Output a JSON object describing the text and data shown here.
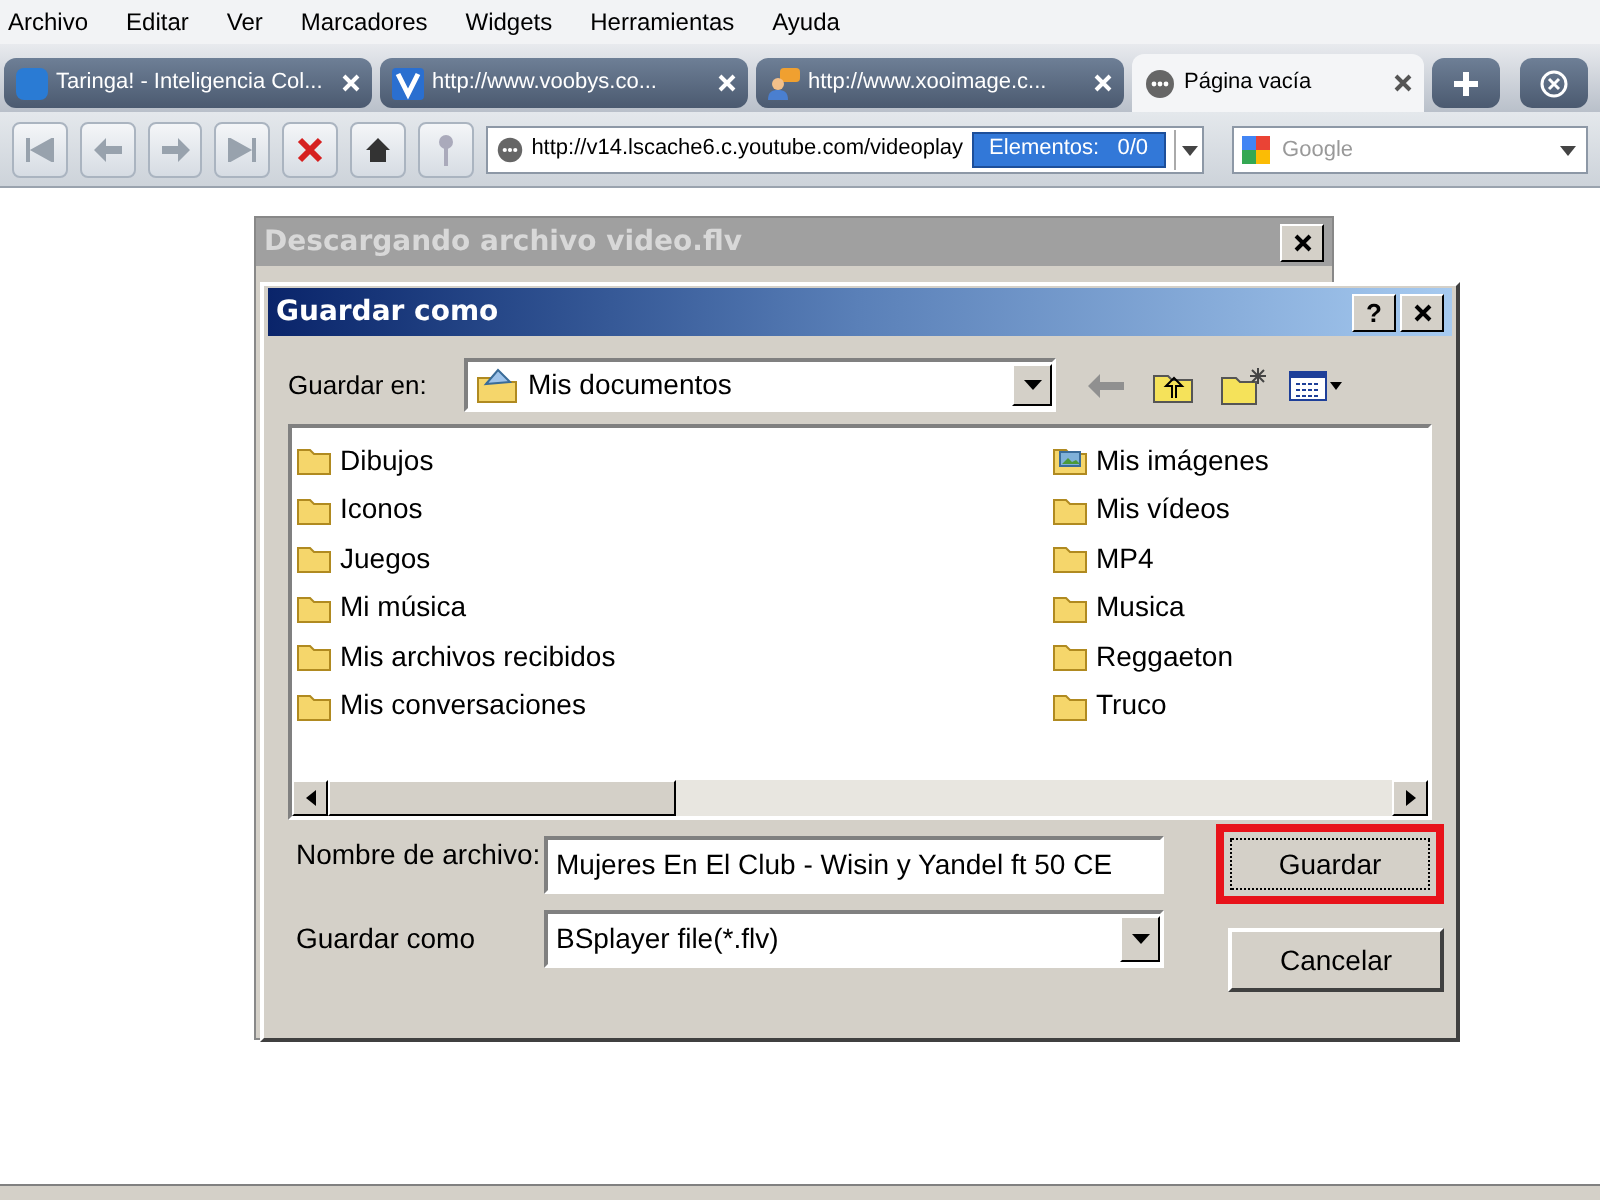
{
  "menu": [
    "Archivo",
    "Editar",
    "Ver",
    "Marcadores",
    "Widgets",
    "Herramientas",
    "Ayuda"
  ],
  "tabs": [
    {
      "label": "Taringa! - Inteligencia Col...",
      "selected": false
    },
    {
      "label": "http://www.voobys.co...",
      "selected": false
    },
    {
      "label": "http://www.xooimage.c...",
      "selected": false
    },
    {
      "label": "Página vacía",
      "selected": true
    }
  ],
  "address": {
    "value": "http://v14.lscache6.c.youtube.com/videoplay",
    "badge": "Elementos:   0/0"
  },
  "search": {
    "placeholder": "Google"
  },
  "back_dialog": {
    "title": "Descargando archivo video.flv"
  },
  "dialog": {
    "title": "Guardar como",
    "help": "?",
    "save_in_label": "Guardar en:",
    "save_in_value": "Mis documentos",
    "files": [
      [
        {
          "name": "Dibujos",
          "kind": "folder"
        },
        {
          "name": "Iconos",
          "kind": "folder"
        },
        {
          "name": "Juegos",
          "kind": "folder"
        },
        {
          "name": "Mi música",
          "kind": "folder"
        },
        {
          "name": "Mis archivos recibidos",
          "kind": "folder"
        },
        {
          "name": "Mis conversaciones",
          "kind": "folder"
        }
      ],
      [
        {
          "name": "Mis imágenes",
          "kind": "pictures"
        },
        {
          "name": "Mis vídeos",
          "kind": "folder"
        },
        {
          "name": "MP4",
          "kind": "folder"
        },
        {
          "name": "Musica",
          "kind": "folder"
        },
        {
          "name": "Reggaeton",
          "kind": "folder"
        },
        {
          "name": "Truco",
          "kind": "folder"
        }
      ]
    ],
    "filename_label": "Nombre de archivo:",
    "filename": "Mujeres En El Club - Wisin y Yandel ft 50 CE",
    "type_label": "Guardar como",
    "type_value": "BSplayer file(*.flv)",
    "buttons": [
      {
        "label": "Guardar",
        "highlighted": true
      },
      {
        "label": "Cancelar",
        "highlighted": false
      }
    ]
  }
}
